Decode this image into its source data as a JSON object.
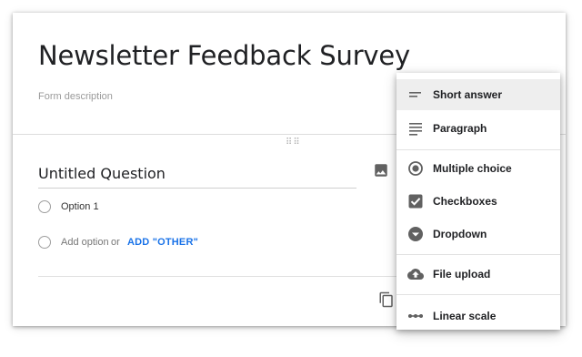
{
  "form": {
    "title": "Newsletter Feedback Survey",
    "description_placeholder": "Form description"
  },
  "question": {
    "title": "Untitled Question",
    "options": [
      {
        "label": "Option 1"
      }
    ],
    "add_option": {
      "label": "Add option",
      "or_text": "or",
      "other_label": "ADD \"OTHER\""
    }
  },
  "type_menu": {
    "items": [
      {
        "label": "Short answer",
        "icon": "short-answer-icon",
        "selected": true
      },
      {
        "label": "Paragraph",
        "icon": "paragraph-icon"
      },
      {
        "label": "Multiple choice",
        "icon": "radio-button-icon"
      },
      {
        "label": "Checkboxes",
        "icon": "checkbox-icon"
      },
      {
        "label": "Dropdown",
        "icon": "dropdown-icon"
      },
      {
        "label": "File upload",
        "icon": "cloud-upload-icon"
      },
      {
        "label": "Linear scale",
        "icon": "linear-scale-icon"
      }
    ]
  },
  "colors": {
    "accent_link": "#1a73e8",
    "menu_selected_bg": "#eeeeee",
    "icon_gray": "#616161"
  }
}
